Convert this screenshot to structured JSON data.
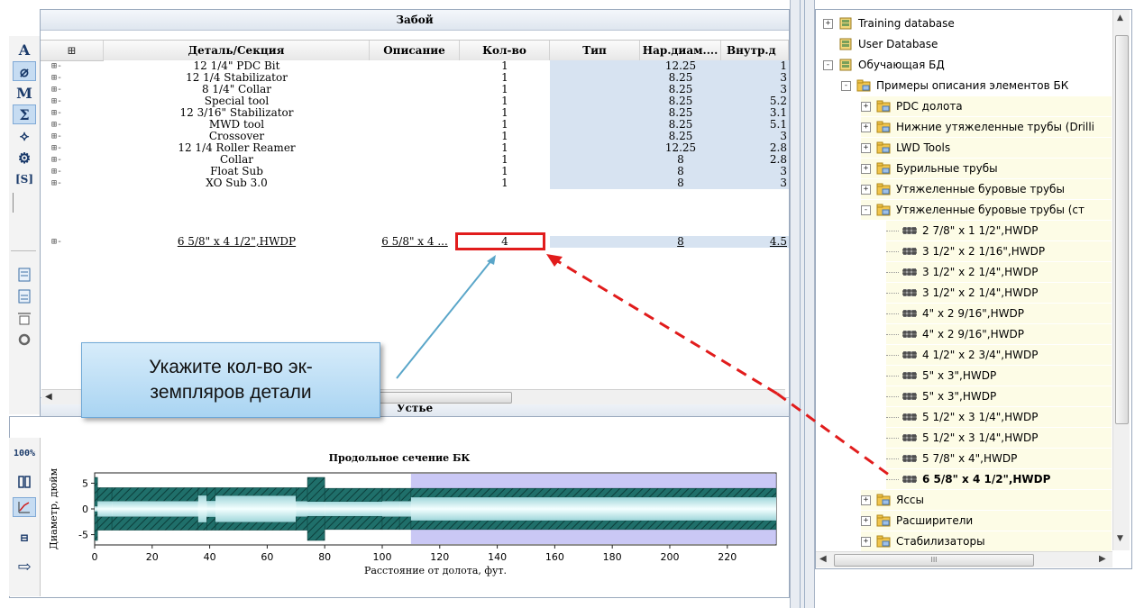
{
  "grid": {
    "title": "Забой",
    "bottom_label": "Устье",
    "expand_all": "⊞",
    "columns": [
      "Деталь/Секция",
      "Описание",
      "Кол-во",
      "Тип",
      "Нар.диам....",
      "Внутр.д"
    ],
    "rows": [
      {
        "name": "12 1/4\" PDC Bit",
        "desc": "",
        "qty": "1",
        "type": "",
        "od": "12.25",
        "id": "1"
      },
      {
        "name": "12 1/4 Stabilizator",
        "desc": "",
        "qty": "1",
        "type": "",
        "od": "8.25",
        "id": "3"
      },
      {
        "name": "8 1/4\" Collar",
        "desc": "",
        "qty": "1",
        "type": "",
        "od": "8.25",
        "id": "3"
      },
      {
        "name": "Special tool",
        "desc": "",
        "qty": "1",
        "type": "",
        "od": "8.25",
        "id": "5.2"
      },
      {
        "name": "12 3/16\" Stabilizator",
        "desc": "",
        "qty": "1",
        "type": "",
        "od": "8.25",
        "id": "3.1"
      },
      {
        "name": "MWD tool",
        "desc": "",
        "qty": "1",
        "type": "",
        "od": "8.25",
        "id": "5.1"
      },
      {
        "name": "Crossover",
        "desc": "",
        "qty": "1",
        "type": "",
        "od": "8.25",
        "id": "3"
      },
      {
        "name": "12 1/4 Roller Reamer",
        "desc": "",
        "qty": "1",
        "type": "",
        "od": "12.25",
        "id": "2.8"
      },
      {
        "name": "Collar",
        "desc": "",
        "qty": "1",
        "type": "",
        "od": "8",
        "id": "2.8"
      },
      {
        "name": "Float Sub",
        "desc": "",
        "qty": "1",
        "type": "",
        "od": "8",
        "id": "3"
      },
      {
        "name": "XO Sub 3.0",
        "desc": "",
        "qty": "1",
        "type": "",
        "od": "8",
        "id": "3"
      },
      {
        "name": "6 5/8\" x 4 1/2\",HWDP",
        "desc": "6 5/8\" x 4 ...",
        "qty": "4",
        "type": "",
        "od": "8",
        "id": "4.5"
      }
    ]
  },
  "left_toolbar": {
    "items": [
      "A",
      "⌀",
      "M",
      "Σ",
      "⟡",
      "⚙",
      "[S]"
    ]
  },
  "callout": {
    "text": "Укажите кол-во эк-\nземпляров детали"
  },
  "chart_toolbar": {
    "zoom_label": "100%"
  },
  "chart_data": {
    "type": "area",
    "title": "Продольное сечение БК",
    "xlabel": "Расстояние от долота, фут.",
    "ylabel": "Диаметр, дюйм",
    "xlim": [
      0,
      237
    ],
    "ylim": [
      -7,
      7
    ],
    "x_ticks": [
      "0",
      "20",
      "40",
      "60",
      "80",
      "100",
      "120",
      "140",
      "160",
      "180",
      "200",
      "220"
    ],
    "y_ticks": [
      "5",
      "0",
      "-5"
    ],
    "segments": [
      {
        "name": "12 1/4\" PDC Bit",
        "x0": 0,
        "x1": 1,
        "od": 12.25,
        "id": 1
      },
      {
        "name": "12 1/4 Stabilizator",
        "x0": 1,
        "x1": 6,
        "od": 8.25,
        "id": 3
      },
      {
        "name": "8 1/4\" Collar",
        "x0": 6,
        "x1": 36,
        "od": 8.25,
        "id": 3
      },
      {
        "name": "Special tool",
        "x0": 36,
        "x1": 39,
        "od": 8.25,
        "id": 5.2
      },
      {
        "name": "12 3/16\" Stabilizator",
        "x0": 39,
        "x1": 42,
        "od": 8.25,
        "id": 3.1
      },
      {
        "name": "MWD tool",
        "x0": 42,
        "x1": 70,
        "od": 8.25,
        "id": 5.1
      },
      {
        "name": "Crossover",
        "x0": 70,
        "x1": 74,
        "od": 8.25,
        "id": 3
      },
      {
        "name": "12 1/4 Roller Reamer",
        "x0": 74,
        "x1": 80,
        "od": 12.25,
        "id": 2.8
      },
      {
        "name": "Collar",
        "x0": 80,
        "x1": 100,
        "od": 8,
        "id": 2.8
      },
      {
        "name": "Float Sub",
        "x0": 100,
        "x1": 106,
        "od": 8,
        "id": 3
      },
      {
        "name": "XO Sub 3.0",
        "x0": 106,
        "x1": 110,
        "od": 8,
        "id": 3
      },
      {
        "name": "6 5/8\" x 4 1/2\",HWDP",
        "x0": 110,
        "x1": 237,
        "od": 8,
        "id": 4.5
      }
    ],
    "colors": {
      "pipe": "#1f6f6a",
      "highlight": "#b8b6f2",
      "bore": "#bfe8ea"
    }
  },
  "tree": {
    "items": [
      {
        "label": "Training database",
        "level": 0,
        "pm": "+",
        "kind": "db"
      },
      {
        "label": "User Database",
        "level": 0,
        "pm": "",
        "kind": "db"
      },
      {
        "label": "Обучающая БД",
        "level": 0,
        "pm": "-",
        "kind": "db"
      },
      {
        "label": "Примеры описания элементов БК",
        "level": 1,
        "pm": "-",
        "kind": "folder"
      },
      {
        "label": "PDC долота",
        "level": 2,
        "pm": "+",
        "kind": "folder"
      },
      {
        "label": "Нижние утяжеленные трубы (Drilli",
        "level": 2,
        "pm": "+",
        "kind": "folder"
      },
      {
        "label": "LWD Tools",
        "level": 2,
        "pm": "+",
        "kind": "folder"
      },
      {
        "label": "Бурильные трубы",
        "level": 2,
        "pm": "+",
        "kind": "folder"
      },
      {
        "label": "Утяжеленные буровые трубы",
        "level": 2,
        "pm": "+",
        "kind": "folder"
      },
      {
        "label": "Утяжеленные буровые трубы (ст",
        "level": 2,
        "pm": "-",
        "kind": "folder"
      },
      {
        "label": "2 7/8\" x 1 1/2\",HWDP",
        "level": 3,
        "pm": "",
        "kind": "pipe"
      },
      {
        "label": "3 1/2\" x 2 1/16\",HWDP",
        "level": 3,
        "pm": "",
        "kind": "pipe"
      },
      {
        "label": "3 1/2\" x 2 1/4\",HWDP",
        "level": 3,
        "pm": "",
        "kind": "pipe"
      },
      {
        "label": "3 1/2\" x 2 1/4\",HWDP",
        "level": 3,
        "pm": "",
        "kind": "pipe"
      },
      {
        "label": "4\" x 2 9/16\",HWDP",
        "level": 3,
        "pm": "",
        "kind": "pipe"
      },
      {
        "label": "4\" x 2 9/16\",HWDP",
        "level": 3,
        "pm": "",
        "kind": "pipe"
      },
      {
        "label": "4 1/2\" x 2 3/4\",HWDP",
        "level": 3,
        "pm": "",
        "kind": "pipe"
      },
      {
        "label": "5\" x 3\",HWDP",
        "level": 3,
        "pm": "",
        "kind": "pipe"
      },
      {
        "label": "5\" x 3\",HWDP",
        "level": 3,
        "pm": "",
        "kind": "pipe"
      },
      {
        "label": "5 1/2\" x 3 1/4\",HWDP",
        "level": 3,
        "pm": "",
        "kind": "pipe"
      },
      {
        "label": "5 1/2\" x 3 1/4\",HWDP",
        "level": 3,
        "pm": "",
        "kind": "pipe"
      },
      {
        "label": "5 7/8\" x 4\",HWDP",
        "level": 3,
        "pm": "",
        "kind": "pipe"
      },
      {
        "label": "6 5/8\" x 4 1/2\",HWDP",
        "level": 3,
        "pm": "",
        "kind": "pipe",
        "bold": true
      },
      {
        "label": "Яссы",
        "level": 2,
        "pm": "+",
        "kind": "folder"
      },
      {
        "label": "Расширители",
        "level": 2,
        "pm": "+",
        "kind": "folder"
      },
      {
        "label": "Стабилизаторы",
        "level": 2,
        "pm": "+",
        "kind": "folder"
      }
    ],
    "hscroll_grip": "III"
  }
}
